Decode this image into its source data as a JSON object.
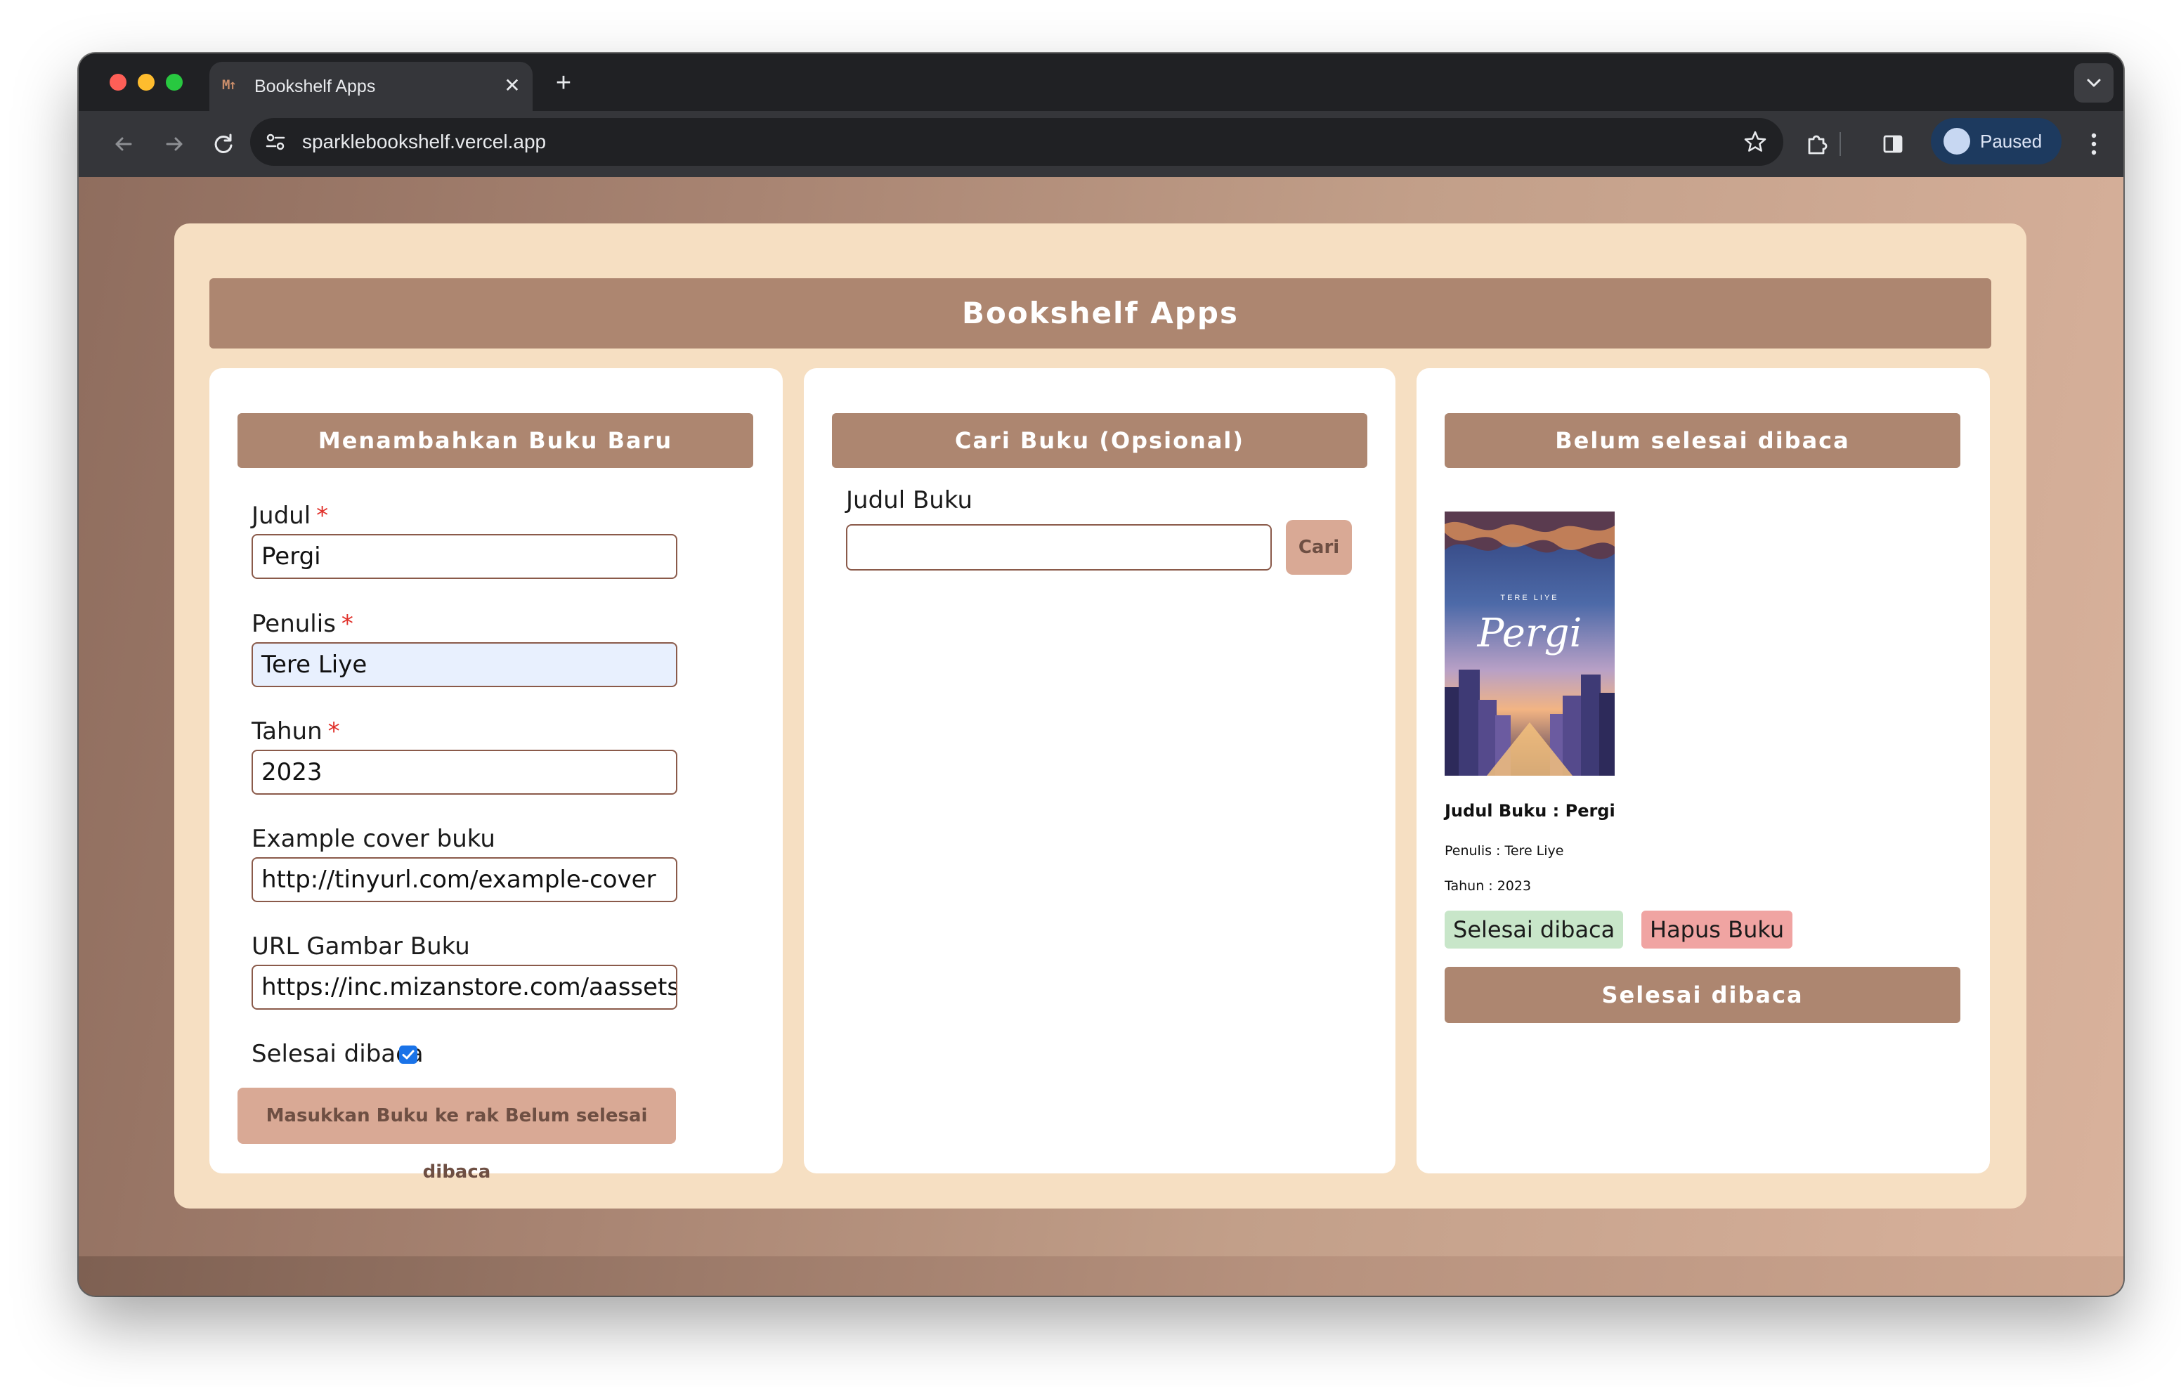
{
  "browser": {
    "tab_title": "Bookshelf Apps",
    "tab_favicon": "M↑",
    "close_glyph": "✕",
    "new_tab_glyph": "+",
    "url": "sparklebookshelf.vercel.app",
    "profile_label": "Paused"
  },
  "app": {
    "title": "Bookshelf Apps"
  },
  "add_form": {
    "heading": "Menambahkan Buku Baru",
    "required_mark": "*",
    "fields": [
      {
        "label": "Judul",
        "value": "Pergi",
        "required": true
      },
      {
        "label": "Penulis",
        "value": "Tere Liye",
        "required": true
      },
      {
        "label": "Tahun",
        "value": "2023",
        "required": true
      },
      {
        "label": "Example cover buku",
        "value": "http://tinyurl.com/example-cover",
        "required": false
      },
      {
        "label": "URL Gambar Buku",
        "value": "https://inc.mizanstore.com/aassets/",
        "required": false
      }
    ],
    "checkbox_label": "Selesai dibaca",
    "checkbox_checked": true,
    "submit_label": "Masukkan Buku ke rak Belum selesai dibaca"
  },
  "search": {
    "heading": "Cari Buku (Opsional)",
    "label": "Judul Buku",
    "value": "",
    "button_label": "Cari"
  },
  "shelf": {
    "heading": "Belum selesai dibaca",
    "book": {
      "cover_author": "TERE LIYE",
      "cover_title": "Pergi",
      "title_line": "Judul Buku : Pergi",
      "author_line": "Penulis : Tere Liye",
      "year_line": "Tahun : 2023",
      "done_label": "Selesai dibaca",
      "delete_label": "Hapus Buku"
    },
    "bottom_heading": "Selesai dibaca"
  },
  "colors": {
    "accent": "#ad8670",
    "button_muted": "#d9a995",
    "panel": "#f6dfc2",
    "chip_green": "#c8e6c9",
    "chip_red": "#f0a4a2"
  }
}
